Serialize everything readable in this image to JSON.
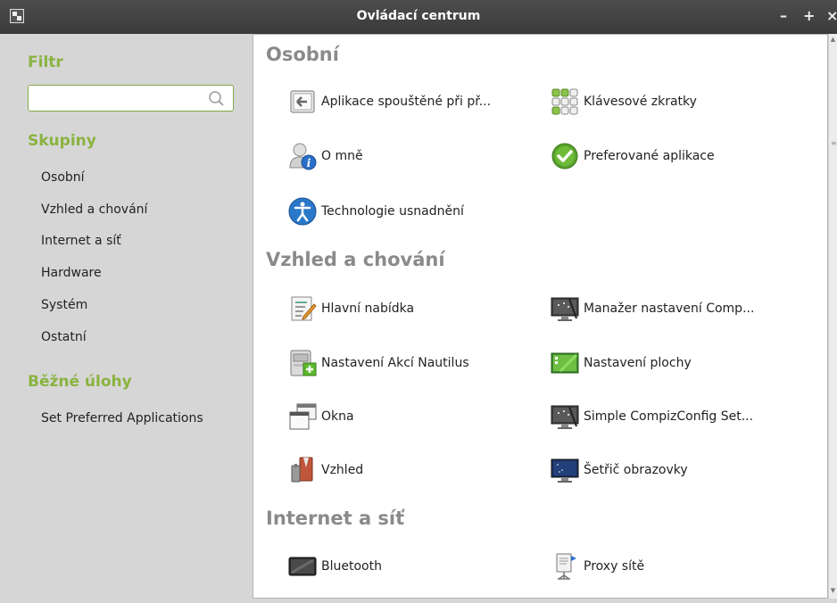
{
  "window": {
    "title": "Ovládací centrum",
    "controls": {
      "minimize": "–",
      "maximize": "+",
      "close": "×"
    }
  },
  "sidebar": {
    "filter_heading": "Filtr",
    "search": {
      "value": "",
      "placeholder": ""
    },
    "groups_heading": "Skupiny",
    "groups": [
      {
        "label": "Osobní"
      },
      {
        "label": "Vzhled a chování"
      },
      {
        "label": "Internet a síť"
      },
      {
        "label": "Hardware"
      },
      {
        "label": "Systém"
      },
      {
        "label": "Ostatní"
      }
    ],
    "tasks_heading": "Běžné úlohy",
    "tasks": [
      {
        "label": "Set Preferred Applications"
      }
    ]
  },
  "sections": [
    {
      "title": "Osobní",
      "items": [
        {
          "label": "Aplikace spouštěné při př...",
          "icon": "startup-apps-icon"
        },
        {
          "label": "Klávesové zkratky",
          "icon": "keyboard-shortcuts-icon"
        },
        {
          "label": "O mně",
          "icon": "about-me-icon"
        },
        {
          "label": "Preferované aplikace",
          "icon": "preferred-apps-icon"
        },
        {
          "label": "Technologie usnadnění",
          "icon": "accessibility-icon"
        }
      ]
    },
    {
      "title": "Vzhled a chování",
      "items": [
        {
          "label": "Hlavní nabídka",
          "icon": "main-menu-icon"
        },
        {
          "label": "Manažer nastavení Comp...",
          "icon": "compiz-manager-icon"
        },
        {
          "label": "Nastavení Akcí Nautilus",
          "icon": "nautilus-actions-icon"
        },
        {
          "label": "Nastavení plochy",
          "icon": "desktop-settings-icon"
        },
        {
          "label": "Okna",
          "icon": "windows-icon"
        },
        {
          "label": "Simple CompizConfig Set...",
          "icon": "simple-compizconfig-icon"
        },
        {
          "label": "Vzhled",
          "icon": "appearance-icon"
        },
        {
          "label": "Šetřič obrazovky",
          "icon": "screensaver-icon"
        }
      ]
    },
    {
      "title": "Internet a síť",
      "items": [
        {
          "label": "Bluetooth",
          "icon": "bluetooth-icon"
        },
        {
          "label": "Proxy sítě",
          "icon": "network-proxy-icon"
        }
      ]
    }
  ]
}
